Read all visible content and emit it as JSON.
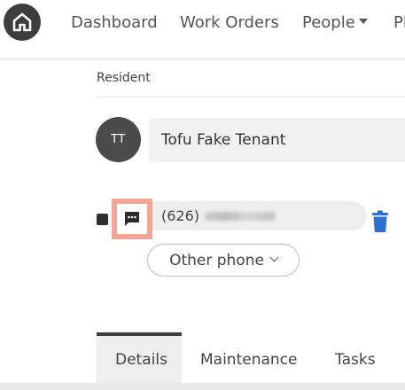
{
  "nav": {
    "logo_icon": "home-house-icon",
    "items": [
      {
        "label": "Dashboard"
      },
      {
        "label": "Work Orders"
      },
      {
        "label": "People"
      },
      {
        "label": "Pl"
      }
    ]
  },
  "resident": {
    "section_label": "Resident",
    "avatar_initials": "TT",
    "name_value": "Tofu Fake Tenant",
    "phone_value": "(626) ",
    "other_phone_label": "Other phone"
  },
  "tabs": [
    {
      "label": "Details",
      "active": true
    },
    {
      "label": "Maintenance",
      "active": false
    },
    {
      "label": "Tasks",
      "active": false
    }
  ],
  "colors": {
    "highlight": "#f3a596",
    "trash": "#2f6fd1",
    "avatar": "#4b4b4b"
  }
}
